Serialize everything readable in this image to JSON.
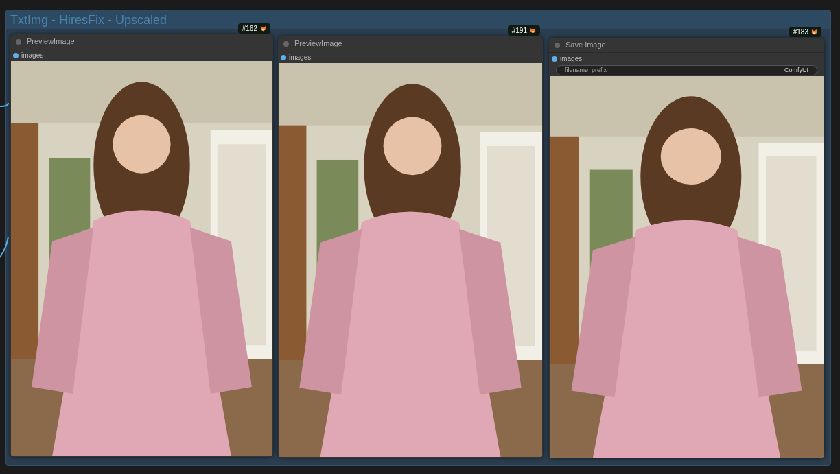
{
  "group": {
    "title": "TxtImg - HiresFix - Upscaled"
  },
  "nodes": [
    {
      "badge": "#162",
      "title": "PreviewImage",
      "inputs": [
        {
          "name": "images"
        }
      ]
    },
    {
      "badge": "#191",
      "title": "PreviewImage",
      "inputs": [
        {
          "name": "images"
        }
      ]
    },
    {
      "badge": "#183",
      "title": "Save Image",
      "inputs": [
        {
          "name": "images"
        }
      ],
      "widgets": [
        {
          "label": "filename_prefix",
          "value": "ComfyUI"
        }
      ]
    }
  ]
}
